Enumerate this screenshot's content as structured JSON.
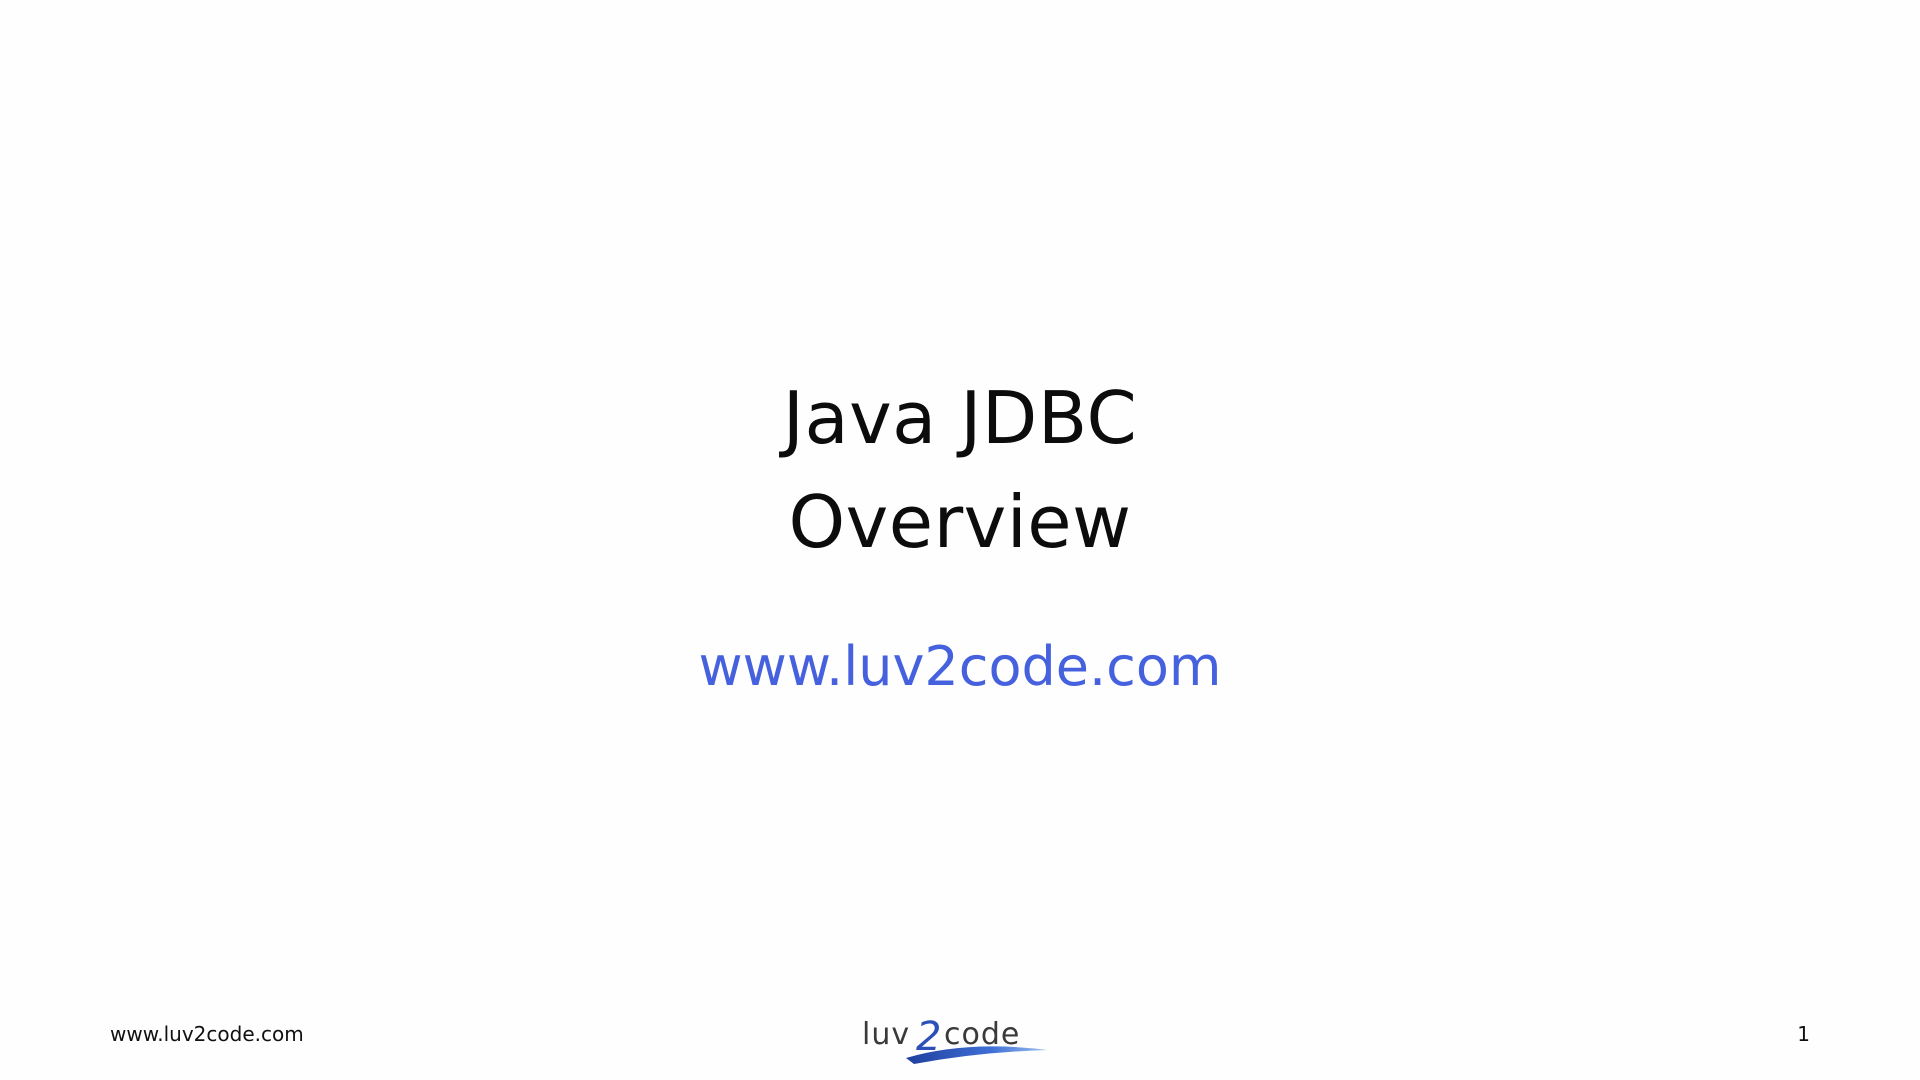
{
  "slide": {
    "title_lines": [
      "Java JDBC",
      "Overview"
    ],
    "subtitle_link": "www.luv2code.com",
    "footer": {
      "left_text": "www.luv2code.com",
      "page_number": "1",
      "logo_text": "luv2code"
    }
  },
  "colors": {
    "background": "#fefefe",
    "title_text": "#0c0c0c",
    "link_blue": "#4661dd",
    "logo_dark": "#3a3a3a",
    "logo_blue": "#2c4fb8"
  }
}
